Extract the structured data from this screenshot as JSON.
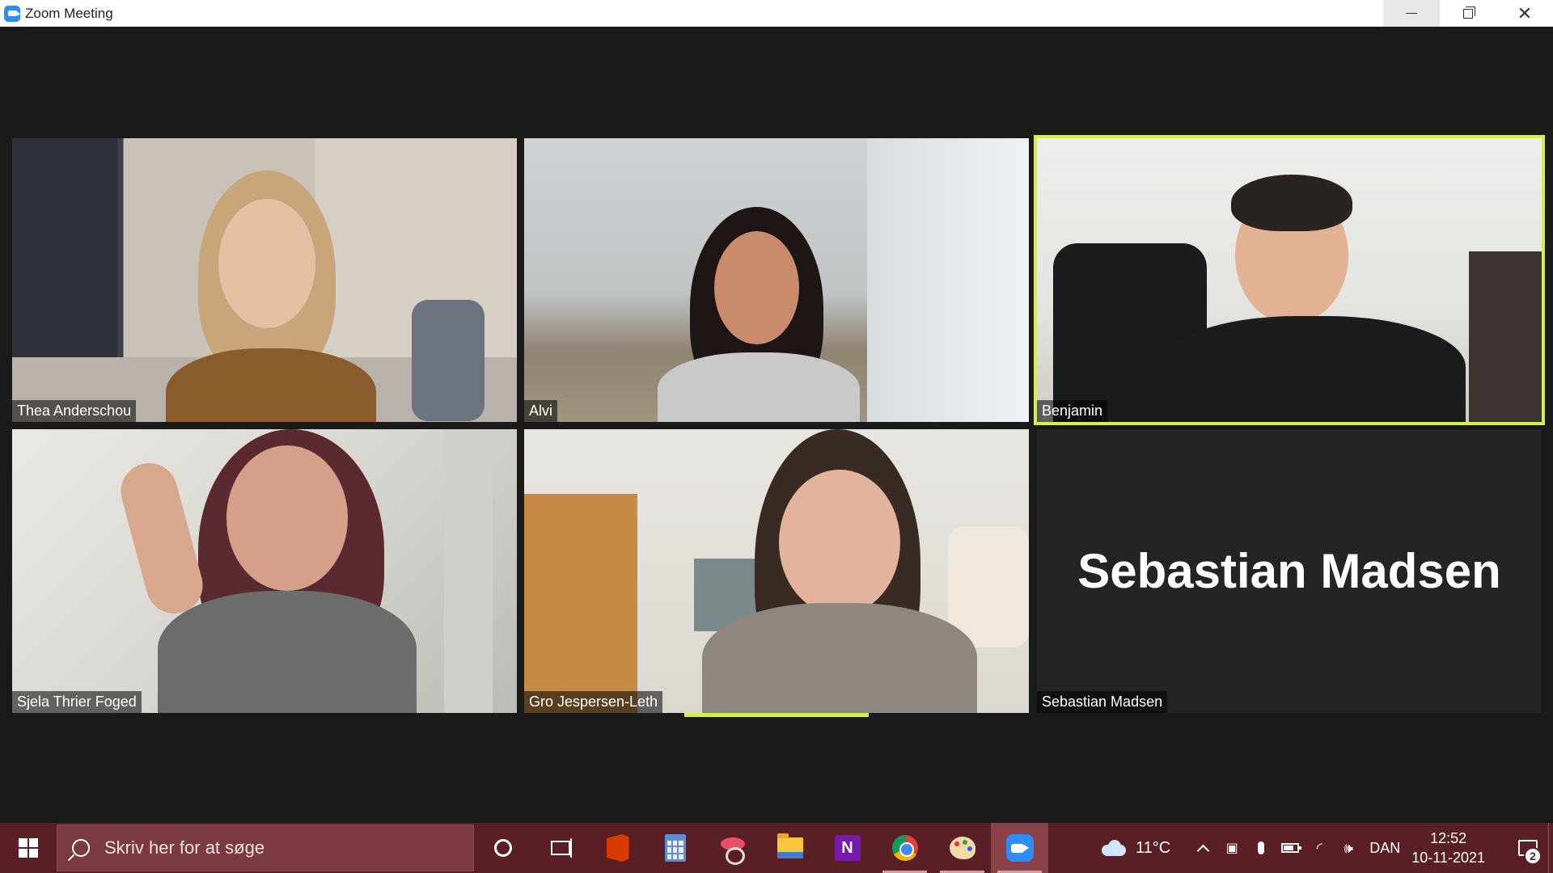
{
  "window": {
    "title": "Zoom Meeting",
    "controls": {
      "minimize": "—",
      "restore": "❐",
      "close": "✕"
    }
  },
  "participants": [
    {
      "name": "Thea Anderschou",
      "video": true
    },
    {
      "name": "Alvi",
      "video": true
    },
    {
      "name": "Benjamin",
      "video": true,
      "active_speaker": true
    },
    {
      "name": "Sjela Thrier Foged",
      "video": true
    },
    {
      "name": "Gro Jespersen-Leth",
      "video": true
    },
    {
      "name": "Sebastian Madsen",
      "video": false,
      "placeholder_text": "Sebastian Madsen"
    }
  ],
  "colors": {
    "active_speaker_border": "#d5ef4c",
    "taskbar": "#5a1e25",
    "zoom_blue": "#2d8cff"
  },
  "taskbar": {
    "search_placeholder": "Skriv her for at søge",
    "pinned_apps": [
      "cortana-icon",
      "task-view-icon",
      "office-icon",
      "calculator-icon",
      "snip-sketch-icon",
      "file-explorer-icon",
      "onenote-icon",
      "chrome-icon",
      "paint-icon",
      "zoom-icon"
    ],
    "onenote_letter": "N",
    "weather": {
      "temperature": "11°C",
      "icon": "cloud-icon"
    },
    "language": "DAN",
    "time": "12:52",
    "date": "10-11-2021",
    "notifications_count": "2"
  }
}
